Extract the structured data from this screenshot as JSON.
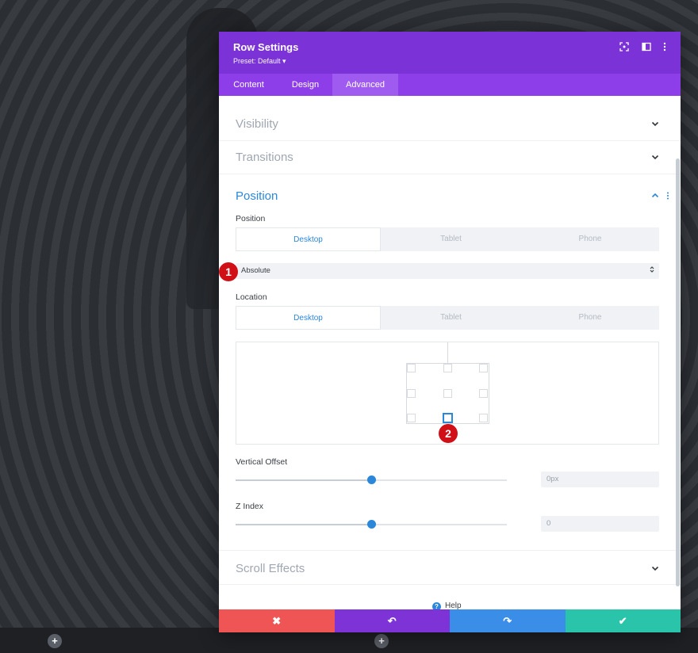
{
  "modal": {
    "title": "Row Settings",
    "preset": "Preset: Default ▾",
    "header_icons": [
      "focus-icon",
      "sidebar-toggle-icon",
      "kebab-menu-icon"
    ],
    "tabs": [
      {
        "label": "Content",
        "active": false
      },
      {
        "label": "Design",
        "active": false
      },
      {
        "label": "Advanced",
        "active": true
      }
    ]
  },
  "sections": {
    "visibility": "Visibility",
    "transitions": "Transitions",
    "position": "Position",
    "scroll_effects": "Scroll Effects"
  },
  "position_panel": {
    "position_label": "Position",
    "device_tabs": [
      "Desktop",
      "Tablet",
      "Phone"
    ],
    "position_value": "Absolute",
    "location_label": "Location",
    "location_tabs": [
      "Desktop",
      "Tablet",
      "Phone"
    ],
    "vertical_offset_label": "Vertical Offset",
    "vertical_offset_value": "0px",
    "vertical_offset_fraction": 0.5,
    "z_index_label": "Z Index",
    "z_index_value": "0",
    "z_index_fraction": 0.5
  },
  "annotations": {
    "badge1": "1",
    "badge2": "2"
  },
  "help": {
    "label": "Help",
    "icon": "?"
  },
  "footer": {
    "cancel": "✖",
    "undo": "↶",
    "redo": "↷",
    "save": "✔"
  },
  "colors": {
    "header": "#7b32d6",
    "tabs": "#8d3ee8",
    "accent_blue": "#2b87da",
    "cancel": "#ef5555",
    "undo": "#7e33d6",
    "redo": "#3b8ee8",
    "save": "#29c4a9",
    "badge": "#d10f17"
  }
}
